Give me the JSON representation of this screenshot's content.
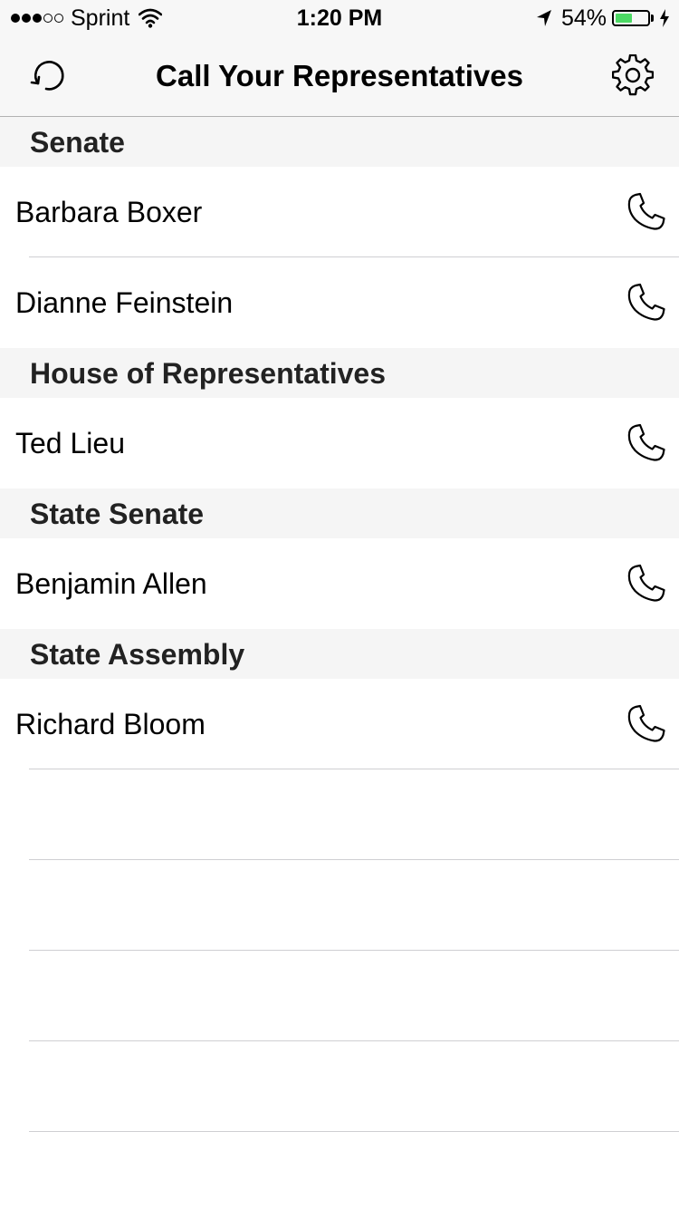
{
  "status_bar": {
    "carrier": "Sprint",
    "time": "1:20 PM",
    "battery_percent": "54%",
    "battery_level": 0.54,
    "signal_bars_filled": 3,
    "signal_bars_total": 5,
    "battery_color": "#4cd964"
  },
  "nav": {
    "title": "Call Your Representatives",
    "left_icon": "refresh-icon",
    "right_icon": "gear-icon"
  },
  "sections": [
    {
      "header": "Senate",
      "rows": [
        {
          "name": "Barbara Boxer"
        },
        {
          "name": "Dianne Feinstein"
        }
      ]
    },
    {
      "header": "House of Representatives",
      "rows": [
        {
          "name": "Ted Lieu"
        }
      ]
    },
    {
      "header": "State Senate",
      "rows": [
        {
          "name": "Benjamin Allen"
        }
      ]
    },
    {
      "header": "State Assembly",
      "rows": [
        {
          "name": "Richard Bloom"
        }
      ]
    }
  ],
  "row_icon": "phone-icon"
}
